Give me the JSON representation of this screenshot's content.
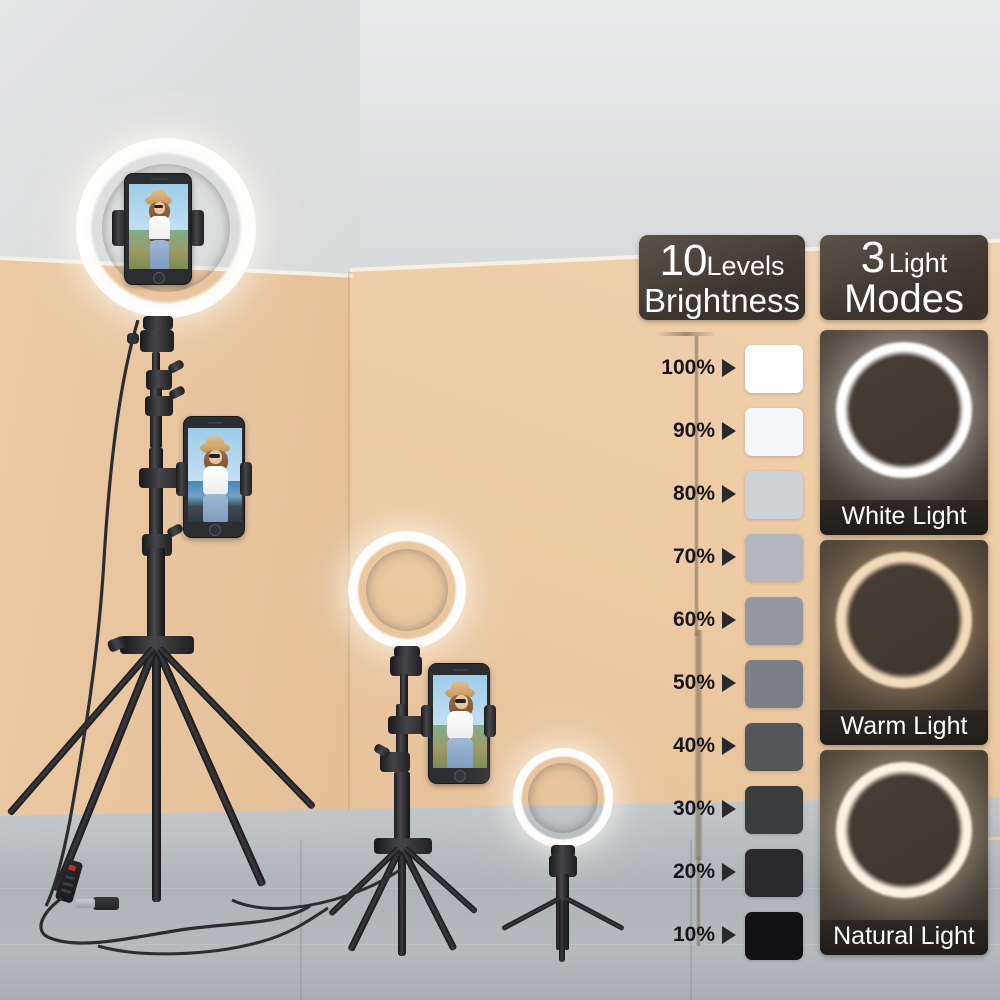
{
  "scene": {
    "description": "Ring light product photo in a room corner",
    "wall_color": "#eac79f",
    "ceiling_color": "#dedfe0",
    "floor_color": "#b4b9bc"
  },
  "brightness_panel": {
    "header": {
      "number": "10",
      "word": "Levels",
      "line2": "Brightness"
    },
    "levels": [
      {
        "label": "100%",
        "color": "#ffffff"
      },
      {
        "label": "90%",
        "color": "#f5f6f7"
      },
      {
        "label": "80%",
        "color": "#cfd2d5"
      },
      {
        "label": "70%",
        "color": "#b4b8bd"
      },
      {
        "label": "60%",
        "color": "#95989e"
      },
      {
        "label": "50%",
        "color": "#7c7f85"
      },
      {
        "label": "40%",
        "color": "#55565a"
      },
      {
        "label": "30%",
        "color": "#3b3c3e"
      },
      {
        "label": "20%",
        "color": "#2a2a2c"
      },
      {
        "label": "10%",
        "color": "#111113"
      }
    ]
  },
  "modes_panel": {
    "header": {
      "number": "3",
      "word": "Light",
      "line2": "Modes"
    },
    "modes": [
      {
        "label": "White Light",
        "ring_color": "#ffffff",
        "glow_color": "#fffdf6"
      },
      {
        "label": "Warm Light",
        "ring_color": "#f3dcbb",
        "glow_color": "#e8c48c"
      },
      {
        "label": "Natural Light",
        "ring_color": "#fdf3e4",
        "glow_color": "#f5e3c8"
      }
    ]
  },
  "products": [
    {
      "name": "tall-tripod-ring-light",
      "size": "large",
      "has_phone": true
    },
    {
      "name": "medium-tripod-ring-light",
      "size": "medium",
      "has_phone": true
    },
    {
      "name": "desktop-mini-ring-light",
      "size": "small",
      "has_phone": false
    }
  ],
  "accessories": {
    "cable": "usb-cable",
    "controller": "inline-dimmer-controller",
    "plug": "usb-plug"
  }
}
